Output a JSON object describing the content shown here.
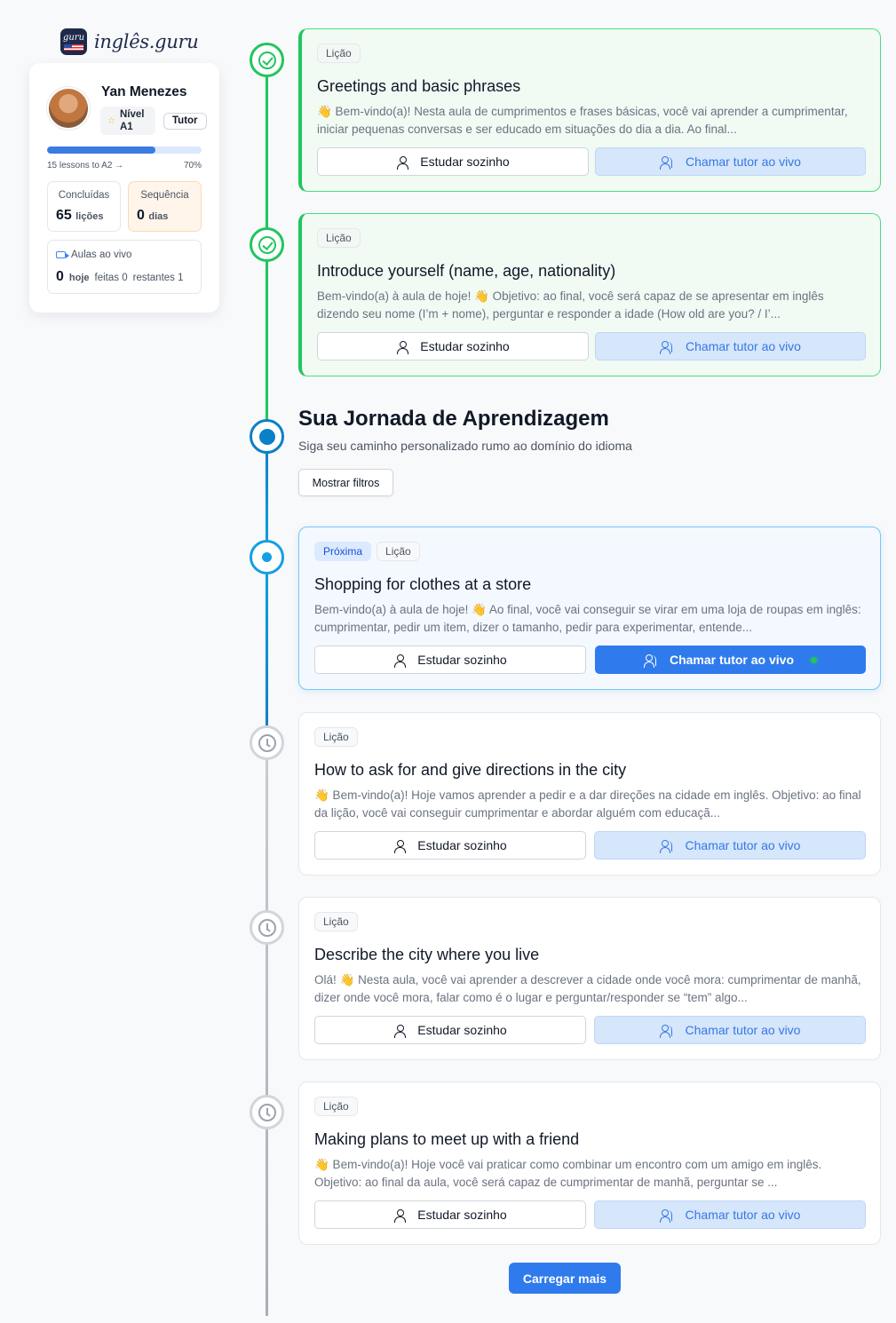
{
  "brand": {
    "name": "inglês.guru",
    "badge_text": "guru"
  },
  "profile": {
    "name": "Yan Menezes",
    "level": "Nível A1",
    "level_line1": "Nível",
    "level_line2": "A1",
    "role": "Tutor",
    "progress_label": "15 lessons to A2 →",
    "progress_percent": "70%",
    "progress_value": 0.7,
    "completed": {
      "title": "Concluídas",
      "value": "65",
      "unit": "lições"
    },
    "streak": {
      "title": "Sequência",
      "value": "0",
      "unit": "dias"
    },
    "live": {
      "title": "Aulas ao vivo",
      "today_value": "0",
      "today_unit": "hoje",
      "done": "feitas 0",
      "remaining": "restantes 1"
    }
  },
  "journey": {
    "title": "Sua Jornada de Aprendizagem",
    "subtitle": "Siga seu caminho personalizado rumo ao domínio do idioma",
    "filter_button": "Mostrar filtros"
  },
  "buttons": {
    "solo": "Estudar sozinho",
    "tutor": "Chamar tutor ao vivo",
    "load_more": "Carregar mais"
  },
  "lessons": [
    {
      "status": "completed",
      "tags": [
        "Lição"
      ],
      "title": "Greetings and basic phrases",
      "description": "👋 Bem-vindo(a)! Nesta aula de cumprimentos e frases básicas, você vai aprender a cumprimentar, iniciar pequenas conversas e ser educado em situações do dia a dia. Ao final..."
    },
    {
      "status": "completed",
      "tags": [
        "Lição"
      ],
      "title": "Introduce yourself (name, age, nationality)",
      "description": "Bem-vindo(a) à aula de hoje! 👋 Objetivo: ao final, você será capaz de se apresentar em inglês dizendo seu nome (I’m + nome), perguntar e responder a idade (How old are you? / I’..."
    },
    {
      "status": "next",
      "tags": [
        "Próxima",
        "Lição"
      ],
      "title": "Shopping for clothes at a store",
      "description": "Bem-vindo(a) à aula de hoje! 👋 Ao final, você vai conseguir se virar em uma loja de roupas em inglês: cumprimentar, pedir um item, dizer o tamanho, pedir para experimentar, entende..."
    },
    {
      "status": "pending",
      "tags": [
        "Lição"
      ],
      "title": "How to ask for and give directions in the city",
      "description": "👋 Bem-vindo(a)! Hoje vamos aprender a pedir e a dar direções na cidade em inglês. Objetivo: ao final da lição, você vai conseguir cumprimentar e abordar alguém com educaçã..."
    },
    {
      "status": "pending",
      "tags": [
        "Lição"
      ],
      "title": "Describe the city where you live",
      "description": "Olá! 👋 Nesta aula, você vai aprender a descrever a cidade onde você mora: cumprimentar de manhã, dizer onde você mora, falar como é o lugar e perguntar/responder se “tem” algo..."
    },
    {
      "status": "pending",
      "tags": [
        "Lição"
      ],
      "title": "Making plans to meet up with a friend",
      "description": "👋 Bem-vindo(a)! Hoje você vai praticar como combinar um encontro com um amigo em inglês. Objetivo: ao final da aula, você será capaz de cumprimentar de manhã, perguntar se ..."
    }
  ],
  "colors": {
    "completed": "#22c55e",
    "journey": "#0b80c7",
    "next": "#13a0e3",
    "pending": "#d1d5db",
    "primary": "#2f7bed"
  }
}
